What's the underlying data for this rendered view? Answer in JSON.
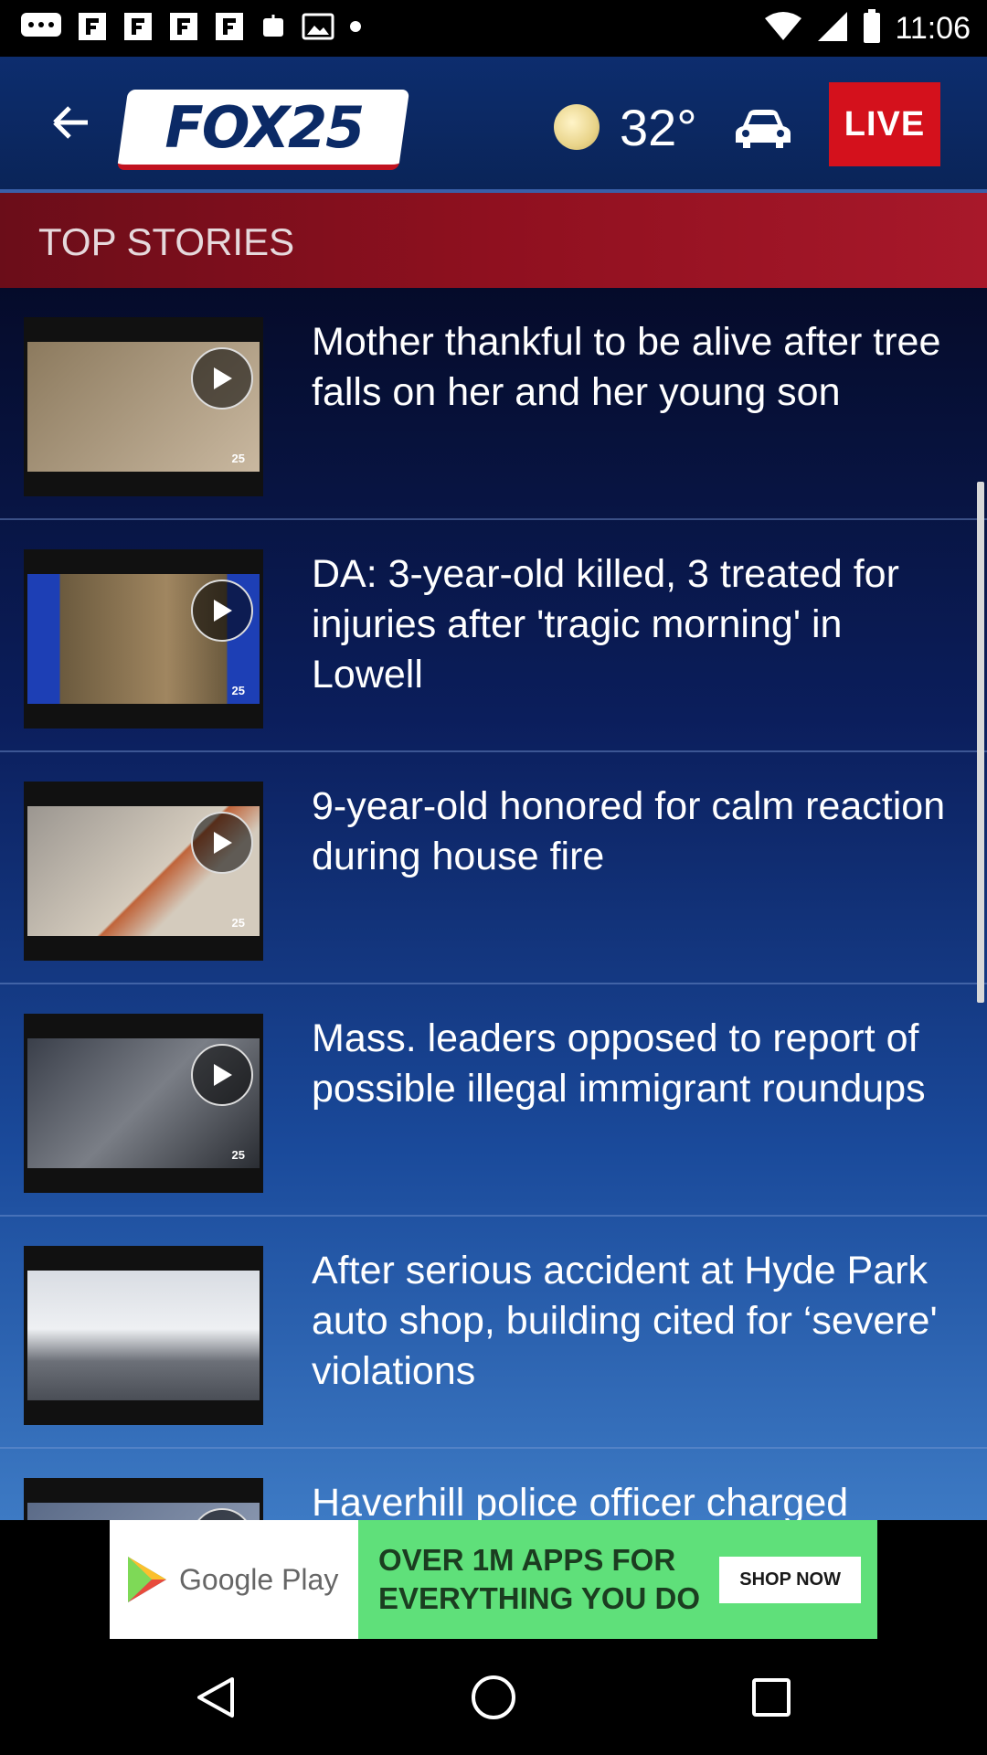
{
  "status_bar": {
    "time": "11:06"
  },
  "header": {
    "logo_text": "FOX25",
    "weather_icon": "moon-icon",
    "temperature": "32°",
    "live_label": "LIVE"
  },
  "banner": {
    "title": "TOP STORIES"
  },
  "stories": [
    {
      "title": "Mother thankful to be alive after tree falls on her and her young son",
      "badge": "25",
      "thumb_colors": [
        "#8c7a5e",
        "#c9b8a0"
      ]
    },
    {
      "title": "DA: 3-year-old killed, 3 treated for injuries after 'tragic morning' in Lowell",
      "badge": "25",
      "thumb_colors": [
        "#1d3fb5",
        "#6b5a3e"
      ]
    },
    {
      "title": "9-year-old honored for calm reaction during house fire",
      "badge": "25",
      "thumb_colors": [
        "#9b9690",
        "#d4cbbd"
      ]
    },
    {
      "title": "Mass. leaders opposed to report of possible illegal immigrant roundups",
      "badge": "25",
      "thumb_colors": [
        "#3a3f4a",
        "#7a7e86"
      ]
    },
    {
      "title": "After serious accident at Hyde Park auto shop, building cited for ‘severe' violations",
      "badge": "",
      "thumb_colors": [
        "#d9dde3",
        "#6c7078"
      ]
    },
    {
      "title": "Haverhill police officer charged",
      "badge": "",
      "thumb_colors": [
        "#5b6b88",
        "#9aa6bd"
      ]
    }
  ],
  "ad": {
    "store_name": "Google Play",
    "headline_line1": "OVER 1M APPS FOR",
    "headline_line2": "EVERYTHING YOU DO",
    "cta": "SHOP NOW"
  },
  "colors": {
    "header_bg": "#0d2d6e",
    "live_red": "#d4111c",
    "banner_red": "#8f101f",
    "ad_green": "#5fe07a"
  }
}
